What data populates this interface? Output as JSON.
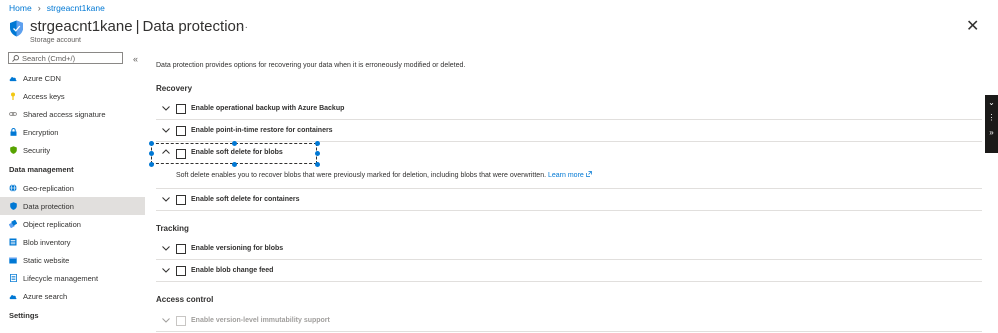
{
  "breadcrumb": {
    "home": "Home",
    "separator": "›",
    "current": "strgeacnt1kane"
  },
  "header": {
    "resource_name": "strgeacnt1kane",
    "separator": "|",
    "blade_name": "Data protection",
    "subtitle": "Storage account",
    "more": "···",
    "close": "✕"
  },
  "search": {
    "placeholder": "Search (Cmd+/)",
    "collapse": "«"
  },
  "sidebar": {
    "items_top": [
      {
        "label": "Azure CDN",
        "icon": "cloud-icon",
        "color": "#0078d4"
      },
      {
        "label": "Access keys",
        "icon": "key-icon",
        "color": "#f2c811"
      },
      {
        "label": "Shared access signature",
        "icon": "link-icon",
        "color": "#8a8886"
      },
      {
        "label": "Encryption",
        "icon": "lock-icon",
        "color": "#0078d4"
      },
      {
        "label": "Security",
        "icon": "shield-icon",
        "color": "#57a300"
      }
    ],
    "section_data_management": "Data management",
    "items_dm": [
      {
        "label": "Geo-replication",
        "icon": "globe-icon",
        "color": "#0078d4"
      },
      {
        "label": "Data protection",
        "icon": "shield-icon",
        "color": "#0078d4",
        "active": true
      },
      {
        "label": "Object replication",
        "icon": "replication-icon",
        "color": "#0078d4"
      },
      {
        "label": "Blob inventory",
        "icon": "inventory-icon",
        "color": "#0078d4"
      },
      {
        "label": "Static website",
        "icon": "website-icon",
        "color": "#0078d4"
      },
      {
        "label": "Lifecycle management",
        "icon": "lifecycle-icon",
        "color": "#0078d4"
      },
      {
        "label": "Azure search",
        "icon": "cloud-search-icon",
        "color": "#0078d4"
      }
    ],
    "section_settings": "Settings"
  },
  "main": {
    "description": "Data protection provides options for recovering your data when it is erroneously modified or deleted.",
    "recovery": {
      "title": "Recovery",
      "options": [
        {
          "label": "Enable operational backup with Azure Backup",
          "expanded": false,
          "checked": false
        },
        {
          "label": "Enable point-in-time restore for containers",
          "expanded": false,
          "checked": false
        },
        {
          "label": "Enable soft delete for blobs",
          "expanded": true,
          "checked": false
        },
        {
          "label": "Enable soft delete for containers",
          "expanded": false,
          "checked": false
        }
      ],
      "soft_delete_blobs_text": "Soft delete enables you to recover blobs that were previously marked for deletion, including blobs that were overwritten.",
      "learn_more": "Learn more"
    },
    "tracking": {
      "title": "Tracking",
      "options": [
        {
          "label": "Enable versioning for blobs",
          "checked": false
        },
        {
          "label": "Enable blob change feed",
          "checked": false
        }
      ]
    },
    "access_control": {
      "title": "Access control",
      "options": [
        {
          "label": "Enable version-level immutability support",
          "checked": false,
          "disabled": true
        }
      ]
    }
  },
  "colors": {
    "accent": "#0078d4",
    "active_bg": "#e1dfdd",
    "text": "#323130"
  }
}
